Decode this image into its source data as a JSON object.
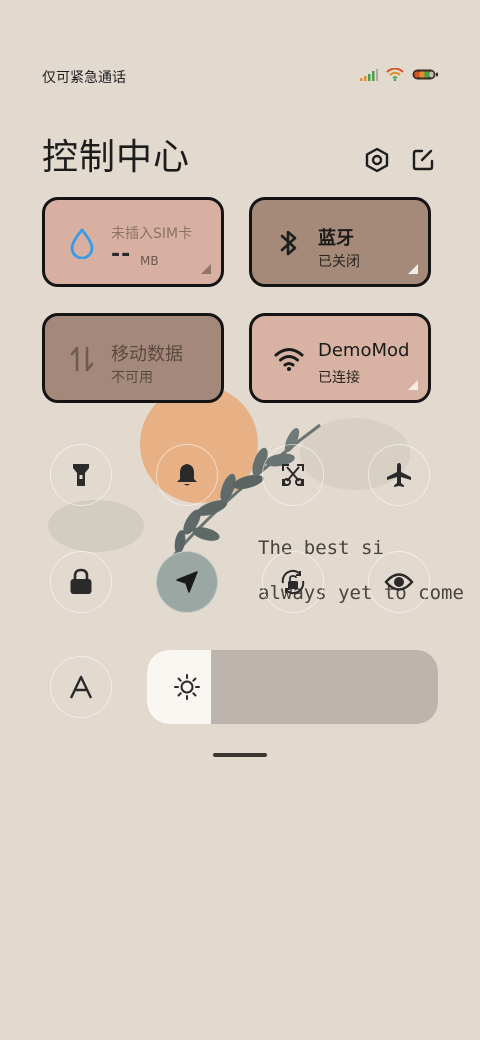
{
  "status_bar": {
    "carrier_text": "仅可紧急通话"
  },
  "header": {
    "title": "控制中心"
  },
  "tiles": {
    "data_usage": {
      "title": "未插入SIM卡",
      "value": "--",
      "unit": "MB"
    },
    "bluetooth": {
      "title": "蓝牙",
      "subtitle": "已关闭"
    },
    "mobile_data": {
      "title": "移动数据",
      "subtitle": "不可用"
    },
    "wifi": {
      "title": "DemoMod",
      "subtitle": "已连接"
    }
  },
  "wallpaper": {
    "line1": "The best si",
    "line2": "always yet to come"
  },
  "brightness": {
    "level": 0.22
  },
  "colors": {
    "data_usage_tile": "#d7b0a1",
    "bluetooth_tile": "#a58a7a",
    "mobile_data_tile": "#a4897a",
    "wifi_tile": "#d8b2a2",
    "accent_blue": "#3a9ae8"
  }
}
